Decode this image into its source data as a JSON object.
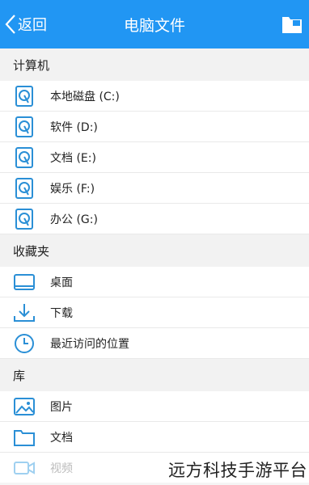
{
  "header": {
    "back_label": "返回",
    "title": "电脑文件",
    "accent_color": "#2196f3"
  },
  "sections": {
    "computer": "计算机",
    "favorites": "收藏夹",
    "library": "库"
  },
  "drives": [
    {
      "label": "本地磁盘 (C:)",
      "icon": "hard-drive-icon"
    },
    {
      "label": "软件 (D:)",
      "icon": "hard-drive-icon"
    },
    {
      "label": "文档 (E:)",
      "icon": "hard-drive-icon"
    },
    {
      "label": "娱乐 (F:)",
      "icon": "hard-drive-icon"
    },
    {
      "label": "办公 (G:)",
      "icon": "hard-drive-icon"
    }
  ],
  "favorites": [
    {
      "label": "桌面",
      "icon": "desktop-icon"
    },
    {
      "label": "下载",
      "icon": "download-icon"
    },
    {
      "label": "最近访问的位置",
      "icon": "clock-icon"
    }
  ],
  "library": [
    {
      "label": "图片",
      "icon": "image-icon"
    },
    {
      "label": "文档",
      "icon": "folder-icon"
    },
    {
      "label": "视频",
      "icon": "video-icon"
    }
  ],
  "watermark": "远方科技手游平台"
}
